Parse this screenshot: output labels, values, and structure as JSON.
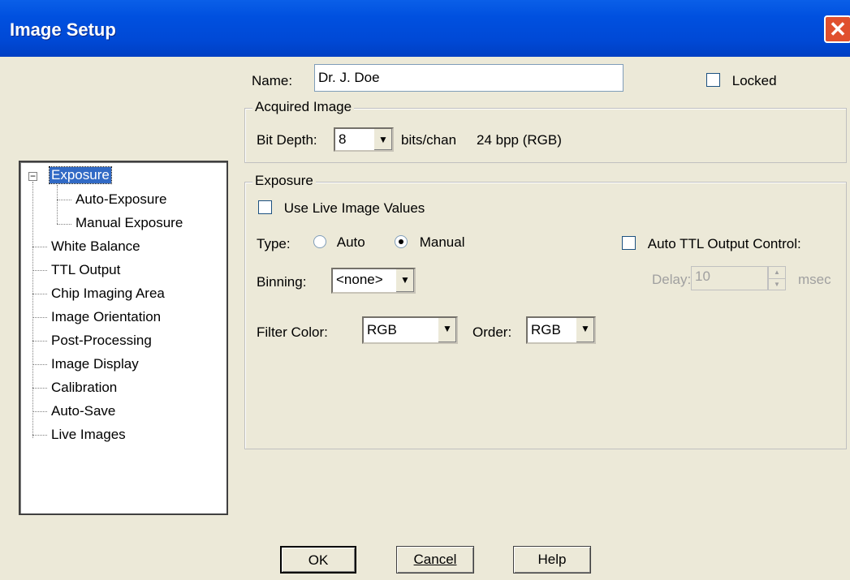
{
  "window": {
    "title": "Image Setup",
    "close_glyph": "✕"
  },
  "name": {
    "label": "Name:",
    "value": "Dr. J. Doe"
  },
  "locked": {
    "label": "Locked",
    "checked": false
  },
  "tree": {
    "expander": "−",
    "items": [
      {
        "label": "Exposure",
        "selected": true
      },
      {
        "label": "Auto-Exposure"
      },
      {
        "label": "Manual Exposure"
      },
      {
        "label": "White Balance"
      },
      {
        "label": "TTL Output"
      },
      {
        "label": "Chip Imaging Area"
      },
      {
        "label": "Image Orientation"
      },
      {
        "label": "Post-Processing"
      },
      {
        "label": "Image Display"
      },
      {
        "label": "Calibration"
      },
      {
        "label": "Auto-Save"
      },
      {
        "label": "Live Images"
      }
    ]
  },
  "acquired": {
    "group_label": "Acquired Image",
    "bit_depth_label": "Bit Depth:",
    "bit_depth_value": "8",
    "bits_label": "bits/chan",
    "bpp_text": "24 bpp (RGB)"
  },
  "exposure": {
    "group_label": "Exposure",
    "use_live_label": "Use Live Image Values",
    "type_label": "Type:",
    "type_auto": "Auto",
    "type_manual": "Manual",
    "type_selected": "Manual",
    "binning_label": "Binning:",
    "binning_value": "<none>",
    "filter_label": "Filter Color:",
    "filter_value": "RGB",
    "order_label": "Order:",
    "order_value": "RGB",
    "auto_ttl_label": "Auto TTL Output Control:",
    "delay_label": "Delay:",
    "delay_value": "10",
    "msec_label": "msec"
  },
  "buttons": {
    "ok": "OK",
    "cancel": "Cancel",
    "help": "Help"
  },
  "colors": {
    "titlebar": "#0050df",
    "selection": "#316ac5",
    "dialog_bg": "#ece9d8"
  },
  "icons": {
    "dropdown": "▼",
    "spin_up": "▲",
    "spin_down": "▼"
  }
}
